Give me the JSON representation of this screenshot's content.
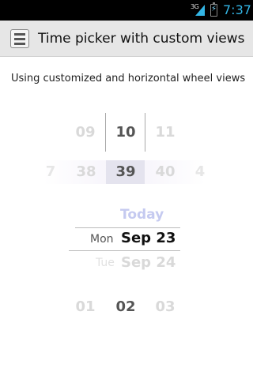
{
  "status_bar": {
    "network": "3G",
    "time": "7:37",
    "time_color": "#33b5e5"
  },
  "title_bar": {
    "title": "Time picker with custom views",
    "icon": "filmstrip-icon"
  },
  "description": "Using customized and horizontal wheel views",
  "hour_wheel": {
    "prev": "09",
    "current": "10",
    "next": "11"
  },
  "minute_wheel": {
    "items": [
      "7",
      "38",
      "39",
      "40",
      "4"
    ],
    "selected": "39"
  },
  "day_wheel": {
    "top": "Today",
    "selected_weekday": "Mon",
    "selected_date": "Sep 23",
    "next_weekday": "Tue",
    "next_date": "Sep 24"
  },
  "ampm_wheel": {
    "prev": "01",
    "current": "02",
    "next": "03"
  },
  "colors": {
    "accent": "#33b5e5",
    "today": "#c5caf0",
    "selection_bg": "#e4e3ee"
  }
}
